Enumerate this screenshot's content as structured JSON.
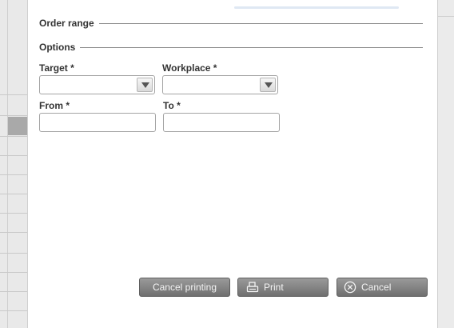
{
  "dialog": {
    "sections": {
      "order_range": "Order range",
      "options": "Options"
    },
    "fields": {
      "target": {
        "label": "Target *",
        "value": ""
      },
      "workplace": {
        "label": "Workplace *",
        "value": ""
      },
      "from": {
        "label": "From *",
        "value": "",
        "placeholder": ""
      },
      "to": {
        "label": "To *",
        "value": "",
        "placeholder": ""
      }
    },
    "buttons": {
      "cancel_printing": "Cancel printing",
      "print": "Print",
      "cancel": "Cancel"
    }
  },
  "icons": {
    "dropdown": "chevron-down-icon",
    "print": "printer-icon",
    "cancel": "close-circle-icon"
  },
  "colors": {
    "button_bg": "#808080",
    "button_text": "#f4f4f4",
    "selected_row": "#a9a9a9"
  }
}
